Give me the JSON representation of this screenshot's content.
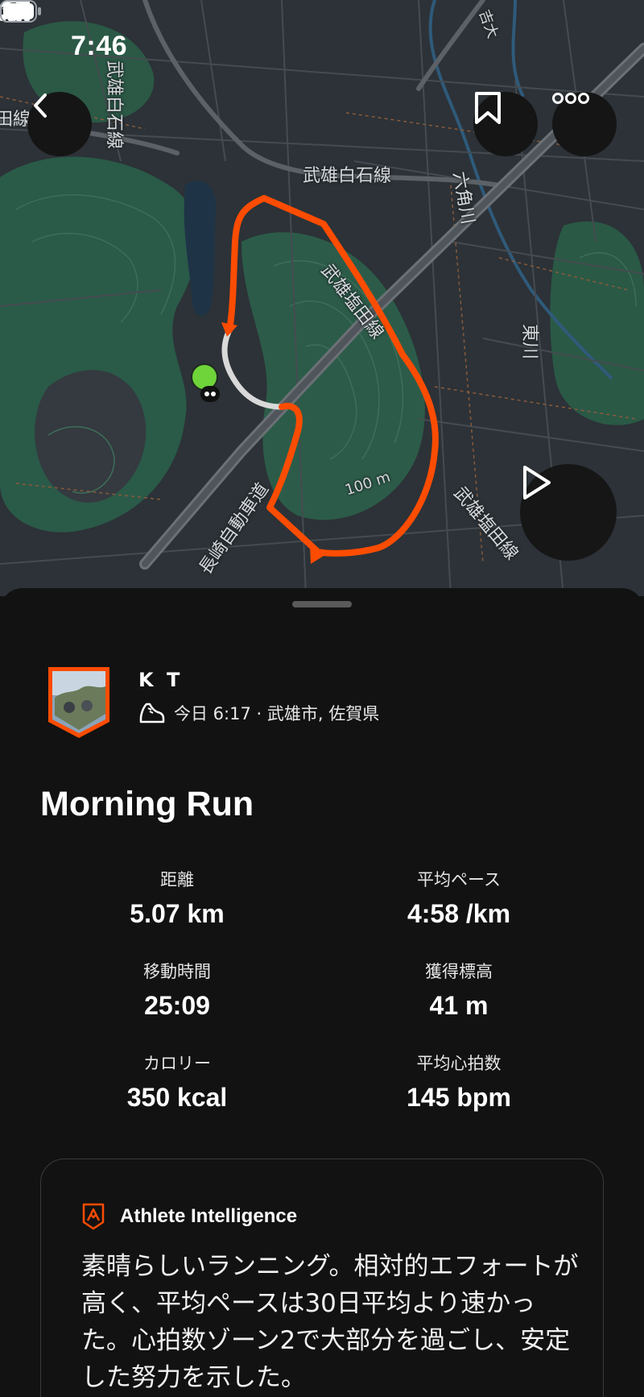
{
  "status_bar": {
    "time": "7:46"
  },
  "map": {
    "labels": {
      "road_top_vertical": "武雄白石線",
      "road_top_right": "武雄白石線",
      "road_diag": "武雄塩田線",
      "road_right": "武雄塩田線",
      "expressway": "長崎自動車道",
      "river_top": "六角川",
      "river_right": "東川",
      "contour": "100 m",
      "left_edge": "田線",
      "top_far": "吉大"
    },
    "icons": {
      "back": "chevron-left-icon",
      "bookmark": "bookmark-icon",
      "more": "more-dots-icon",
      "play": "play-icon"
    },
    "colors": {
      "route": "#fc4c02",
      "start_marker": "#6fd43a"
    }
  },
  "activity": {
    "athlete_name": "K T",
    "meta": "今日 6:17 · 武雄市, 佐賀県",
    "title": "Morning Run",
    "stats": [
      {
        "label": "距離",
        "value": "5.07 km"
      },
      {
        "label": "平均ペース",
        "value": "4:58 /km"
      },
      {
        "label": "移動時間",
        "value": "25:09"
      },
      {
        "label": "獲得標高",
        "value": "41 m"
      },
      {
        "label": "カロリー",
        "value": "350 kcal"
      },
      {
        "label": "平均心拍数",
        "value": "145 bpm"
      }
    ]
  },
  "athlete_intelligence": {
    "title": "Athlete Intelligence",
    "body": "素晴らしいランニング。相対的エフォートが高く、平均ペースは30日平均より速かった。心拍数ゾーン2で大部分を過ごし、安定した努力を示した。"
  }
}
